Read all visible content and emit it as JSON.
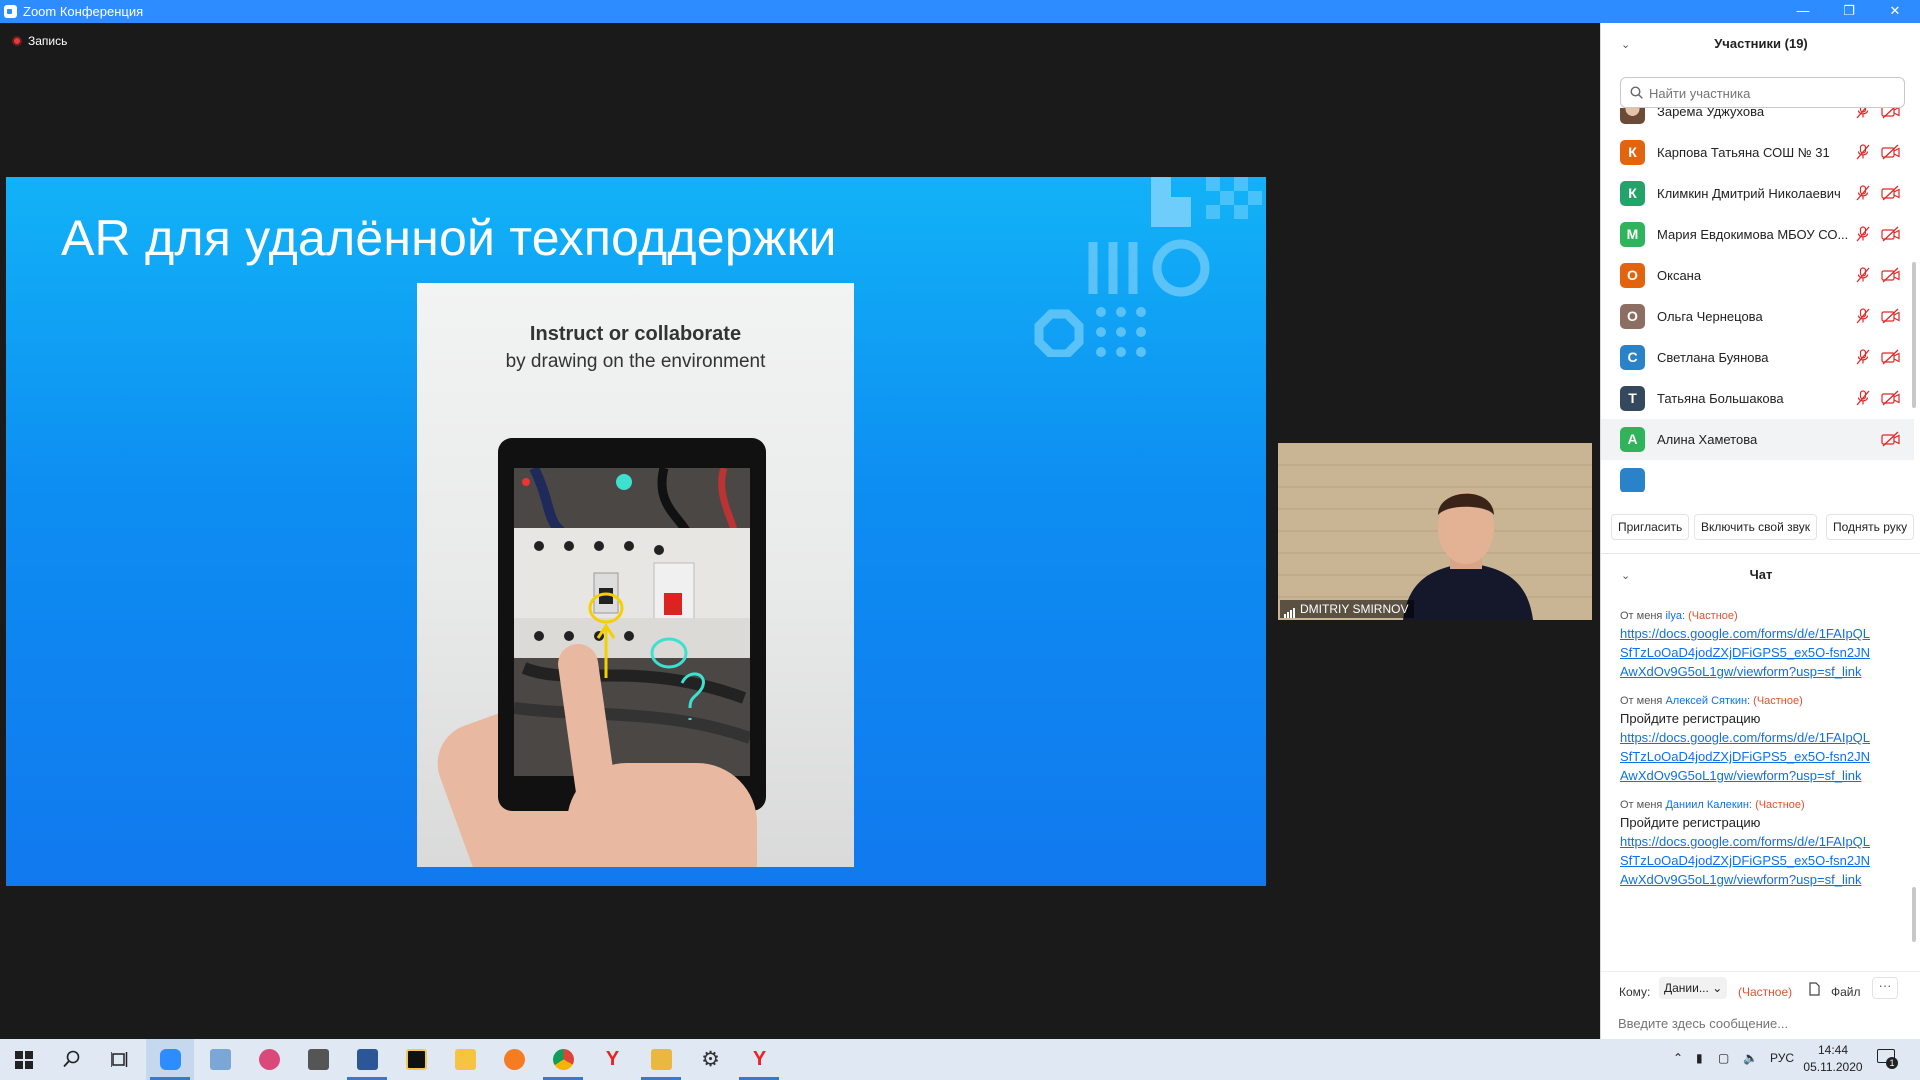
{
  "window": {
    "title": "Zoom Конференция",
    "controls": [
      "—",
      "❐",
      "✕"
    ]
  },
  "recording": {
    "label": "Запись"
  },
  "slide": {
    "title": "AR для удалённой техподдержки",
    "photo_heading": "Instruct or collaborate",
    "photo_subheading": "by drawing on the environment"
  },
  "video_thumb": {
    "name": "DMITRIY SMIRNOV"
  },
  "participants": {
    "title": "Участники (19)",
    "search_placeholder": "Найти участника",
    "list": [
      {
        "initial": "",
        "name": "Зарема Уджухова",
        "color": "#b07b5a",
        "photo": true,
        "mic": "muted",
        "cam": "off"
      },
      {
        "initial": "К",
        "name": "Карпова Татьяна СОШ № 31",
        "color": "#e3640f",
        "mic": "muted",
        "cam": "off"
      },
      {
        "initial": "К",
        "name": "Климкин Дмитрий Николаевич",
        "color": "#23a36a",
        "mic": "muted",
        "cam": "off"
      },
      {
        "initial": "М",
        "name": "Мария Евдокимова МБОУ СО...",
        "color": "#2fb35b",
        "mic": "muted",
        "cam": "off"
      },
      {
        "initial": "О",
        "name": "Оксана",
        "color": "#e3640f",
        "mic": "muted",
        "cam": "off"
      },
      {
        "initial": "О",
        "name": "Ольга Чернецова",
        "color": "#8d6e63",
        "mic": "muted",
        "cam": "off"
      },
      {
        "initial": "С",
        "name": "Светлана Буянова",
        "color": "#2a82c9",
        "mic": "muted",
        "cam": "off"
      },
      {
        "initial": "Т",
        "name": "Татьяна Большакова",
        "color": "#34495e",
        "mic": "muted",
        "cam": "off"
      },
      {
        "initial": "А",
        "name": "Алина Хаметова",
        "color": "#2fb35b",
        "mic": "none",
        "cam": "off",
        "selected": true
      }
    ],
    "actions": {
      "invite": "Пригласить",
      "unmute": "Включить свой звук",
      "raise_hand": "Поднять руку"
    }
  },
  "chat": {
    "title": "Чат",
    "messages": [
      {
        "prefix": "От меня",
        "to": "ilya:",
        "privacy": "(Частное)",
        "text": "",
        "link": "https://docs.google.com/forms/d/e/1FAIpQLSfTzLoOaD4jodZXjDFiGPS5_ex5O-fsn2JNAwXdOv9G5oL1gw/viewform?usp=sf_link"
      },
      {
        "prefix": "От меня",
        "to": "Алексей Сяткин:",
        "privacy": "(Частное)",
        "text": "Пройдите регистрацию",
        "link": "https://docs.google.com/forms/d/e/1FAIpQLSfTzLoOaD4jodZXjDFiGPS5_ex5O-fsn2JNAwXdOv9G5oL1gw/viewform?usp=sf_link"
      },
      {
        "prefix": "От меня",
        "to": "Даниил Калекин:",
        "privacy": "(Частное)",
        "text": "Пройдите регистрацию",
        "link": "https://docs.google.com/forms/d/e/1FAIpQLSfTzLoOaD4jodZXjDFiGPS5_ex5O-fsn2JNAwXdOv9G5oL1gw/viewform?usp=sf_link"
      }
    ],
    "compose": {
      "to_label": "Кому:",
      "recipient": "Дании...",
      "privacy": "(Частное)",
      "file_label": "Файл",
      "more": "···",
      "placeholder": "Введите здесь сообщение..."
    }
  },
  "taskbar": {
    "apps": [
      "start-menu",
      "search",
      "task-view",
      "zoom",
      "remote-desktop",
      "paint",
      "calculator",
      "word",
      "kaspersky",
      "notes",
      "firefox",
      "chrome",
      "yandex-browser",
      "file-explorer",
      "settings",
      "yandex-browser-2"
    ],
    "language": "РУС",
    "time": "14:44",
    "date": "05.11.2020",
    "notifications": "1"
  },
  "colors": {
    "zoom_blue": "#2d8cff",
    "link_blue": "#0e71eb",
    "private_red": "#e0522e",
    "muted_red": "#e02828"
  }
}
